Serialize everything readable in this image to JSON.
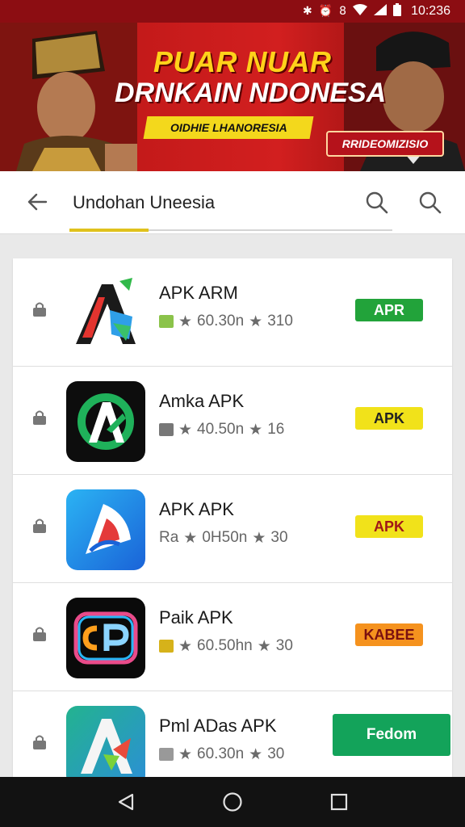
{
  "status_bar": {
    "time": "10:236",
    "icons": [
      "bluetooth-icon",
      "alarm-icon",
      "vibrate-icon",
      "wifi-icon",
      "signal-icon",
      "battery-icon"
    ]
  },
  "banner": {
    "headline1": "PUAR NUAR",
    "headline2": "DRNKAIN NDONESA",
    "subtitle": "OIDHIE LHANORESIA",
    "cta": "RRIDEOMIZISIO"
  },
  "search": {
    "query": "Undohan Uneesia"
  },
  "apps": [
    {
      "name": "APK ARM",
      "meta_size": "60.30n",
      "meta_rating": "310",
      "badge": "APR",
      "badge_bg": "#22a33a",
      "badge_fg": "#ffffff",
      "mini_color": "#8bc34a"
    },
    {
      "name": "Amka APK",
      "meta_size": "40.50n",
      "meta_rating": "16",
      "badge": "APK",
      "badge_bg": "#f1e21a",
      "badge_fg": "#222222",
      "mini_color": "#777777"
    },
    {
      "name": "APK APK",
      "meta_prefix": "Ra",
      "meta_size": "0H50n",
      "meta_rating": "30",
      "badge": "APK",
      "badge_bg": "#f1e21a",
      "badge_fg": "#a01818",
      "mini_color": ""
    },
    {
      "name": "Paik APK",
      "meta_size": "60.50hn",
      "meta_rating": "30",
      "badge": "KABEE",
      "badge_bg": "#f5921e",
      "badge_fg": "#7a1010",
      "mini_color": "#d6b21a"
    },
    {
      "name": "Pml ADas APK",
      "meta_size": "60.30n",
      "meta_rating": "30",
      "install": "Fedom",
      "mini_color": "#999999"
    }
  ],
  "colors": {
    "accent_yellow": "#e0c21c",
    "banner_red": "#c41a1a",
    "install_green": "#13a35a"
  }
}
